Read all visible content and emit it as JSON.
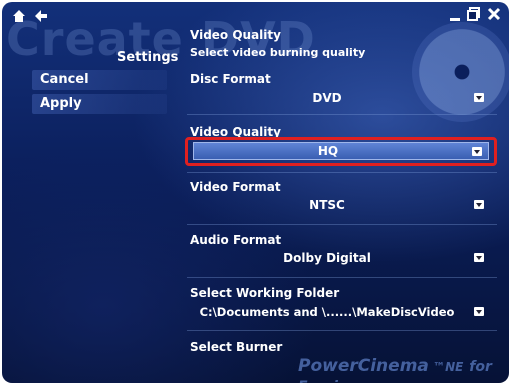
{
  "header": {
    "background_title": "Create DVD"
  },
  "sidebar": {
    "section_label": "Settings",
    "items": [
      {
        "label": "Cancel"
      },
      {
        "label": "Apply"
      }
    ]
  },
  "panel": {
    "title": "Video Quality",
    "subtitle": "Select video burning quality",
    "fields": [
      {
        "label": "Disc Format",
        "value": "DVD"
      },
      {
        "label": "Video Quality",
        "value": "HQ"
      },
      {
        "label": "Video Format",
        "value": "NTSC"
      },
      {
        "label": "Audio Format",
        "value": "Dolby Digital"
      },
      {
        "label": "Select Working Folder",
        "value": "C:\\Documents and \\......\\MakeDiscVideo"
      },
      {
        "label": "Select Burner",
        "value": ""
      }
    ]
  },
  "branding": {
    "product": "PowerCinema",
    "edition": "NE",
    "tagline": "for Everio"
  },
  "colors": {
    "background_top": "#13307a",
    "background_bottom": "#061236",
    "selected_fill": "#4a70c4",
    "highlight_border": "#e02020"
  },
  "icons": {
    "home": "home-icon",
    "back": "back-arrow-icon",
    "minimize": "minimize-icon",
    "restore": "restore-icon",
    "close": "close-icon",
    "dropdown": "chevron-down-icon"
  }
}
